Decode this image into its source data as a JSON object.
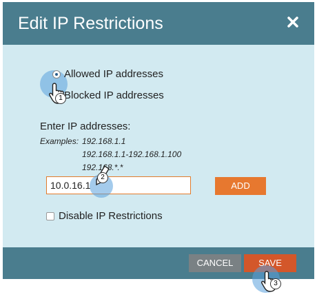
{
  "dialog": {
    "title": "Edit IP Restrictions",
    "close_icon": "close-icon"
  },
  "restriction_type": {
    "options": [
      {
        "label": "Allowed IP addresses",
        "checked": true
      },
      {
        "label": "Blocked IP addresses",
        "checked": false
      }
    ]
  },
  "ip_entry": {
    "label": "Enter IP addresses:",
    "examples_label": "Examples:",
    "examples": [
      "192.168.1.1",
      "192.168.1.1-192.168.1.100",
      "192.168.*.*"
    ],
    "value": "10.0.16.1",
    "add_label": "ADD"
  },
  "disable": {
    "label": "Disable IP Restrictions",
    "checked": false
  },
  "footer": {
    "cancel_label": "CANCEL",
    "save_label": "SAVE"
  },
  "tutorial_markers": [
    "1",
    "2",
    "3"
  ]
}
